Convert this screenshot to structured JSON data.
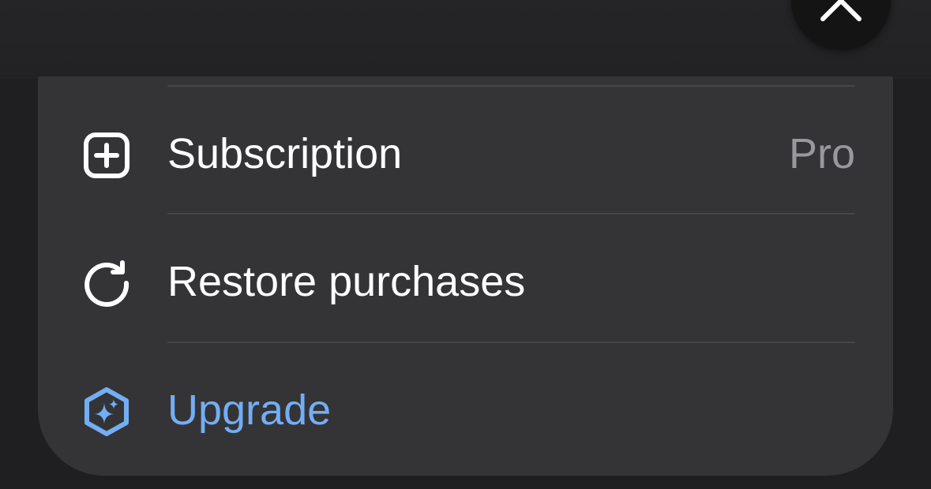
{
  "menu": {
    "items": [
      {
        "label": "Subscription",
        "value": "Pro",
        "icon": "plus-square-icon"
      },
      {
        "label": "Restore purchases",
        "icon": "refresh-icon"
      },
      {
        "label": "Upgrade",
        "icon": "sparkle-hexagon-icon"
      }
    ]
  },
  "colors": {
    "card_background": "#343436",
    "accent": "#73aef5",
    "text": "#ffffff",
    "secondary_text": "#98989d"
  }
}
